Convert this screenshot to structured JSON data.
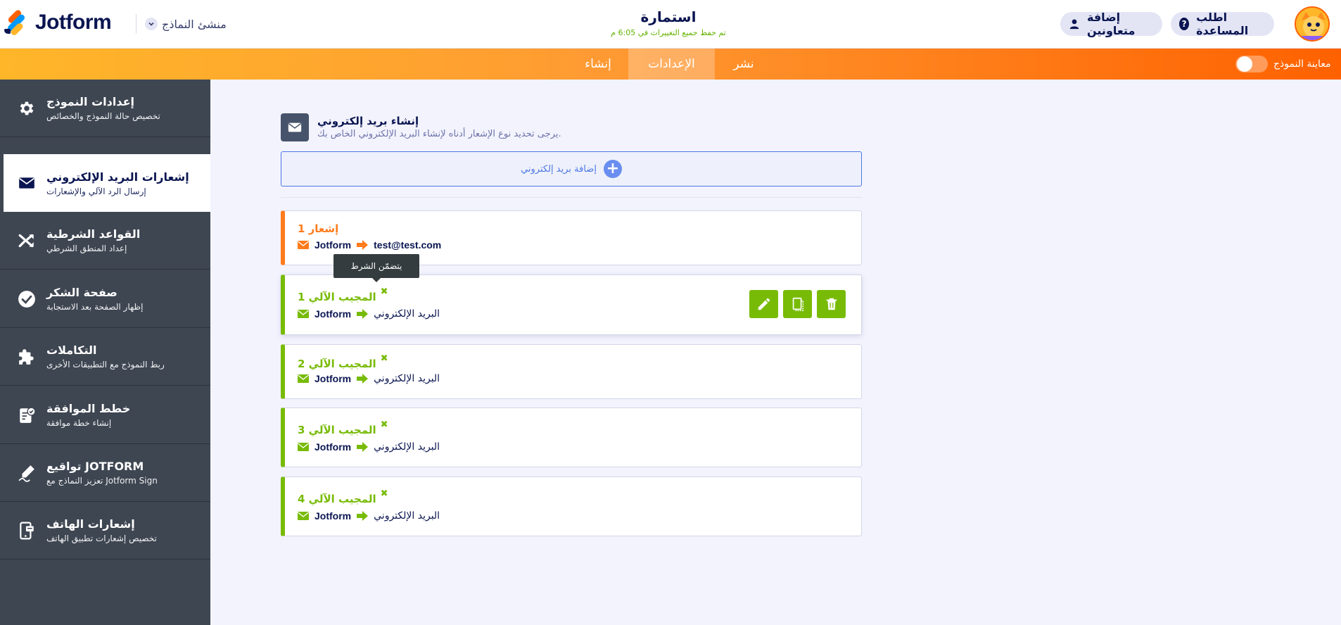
{
  "header": {
    "brand": "Jotform",
    "builder_menu": "منشئ النماذج",
    "form_title": "استمارة",
    "save_status": "تم حفظ جميع التغييرات في 6:05 م",
    "help_button": "اطلب المساعدة",
    "help_icon_glyph": "?",
    "collaborators_button": "إضافة متعاونين"
  },
  "navbar": {
    "tabs": [
      "نشر",
      "الإعدادات",
      "إنشاء"
    ],
    "active_tab": "الإعدادات",
    "preview_label": "معاينة النموذج",
    "preview_enabled": false
  },
  "sidebar": {
    "items": [
      {
        "title": "إعدادات النموذج",
        "subtitle": "تخصيص حالة النموذج والخصائص",
        "icon": "gear-icon"
      },
      {
        "title": "إشعارات البريد الإلكتروني",
        "subtitle": "إرسال الرد الآلي والإشعارات",
        "icon": "envelope-icon",
        "active": true
      },
      {
        "title": "القواعد الشرطية",
        "subtitle": "إعداد المنطق الشرطي",
        "icon": "shuffle-icon"
      },
      {
        "title": "صفحة الشكر",
        "subtitle": "إظهار الصفحة بعد الاستجابة",
        "icon": "check-circle-icon"
      },
      {
        "title": "التكاملات",
        "subtitle": "ربط النموذج مع التطبيقات الأخرى",
        "icon": "puzzle-icon"
      },
      {
        "title": "خطط الموافقة",
        "subtitle": "إنشاء خطة موافقة",
        "icon": "approval-icon"
      },
      {
        "title": "تواقيع JOTFORM",
        "subtitle": "تعزيز النماذج مع Jotform Sign",
        "icon": "signature-pen-icon"
      },
      {
        "title": "إشعارات الهاتف",
        "subtitle": "تخصيص إشعارات تطبيق الهاتف",
        "icon": "mobile-icon"
      }
    ]
  },
  "main": {
    "create_title": "إنشاء بريد إلكتروني",
    "create_subtitle": "يرجى تحديد نوع الإشعار أدناه لإنشاء البريد الإلكتروني الخاص بك.",
    "add_email_label": "إضافة بريد إلكتروني",
    "add_icon_glyph": "+",
    "condition_icon_glyph": "✖",
    "tooltip": "يتضمّن الشرط",
    "cards": [
      {
        "title": "إشعار 1",
        "from": "Jotform",
        "to": "test@test.com",
        "kind": "notification",
        "has_condition": false
      },
      {
        "title": "المجيب الآلي 1",
        "from": "Jotform",
        "to": "البريد الإلكتروني",
        "kind": "autoresponder",
        "has_condition": true
      },
      {
        "title": "المجيب الآلي 2",
        "from": "Jotform",
        "to": "البريد الإلكتروني",
        "kind": "autoresponder",
        "has_condition": true
      },
      {
        "title": "المجيب الآلي 3",
        "from": "Jotform",
        "to": "البريد الإلكتروني",
        "kind": "autoresponder",
        "has_condition": true
      },
      {
        "title": "المجيب الآلي 4",
        "from": "Jotform",
        "to": "البريد الإلكتروني",
        "kind": "autoresponder",
        "has_condition": true
      }
    ]
  },
  "colors": {
    "nav_gradient_start": "#ffb629",
    "nav_gradient_end": "#ff6100",
    "sidebar_bg": "#3e4652",
    "green_accent": "#78bb07",
    "orange_accent": "#ff7b1c",
    "blue_accent": "#4d76e6"
  }
}
